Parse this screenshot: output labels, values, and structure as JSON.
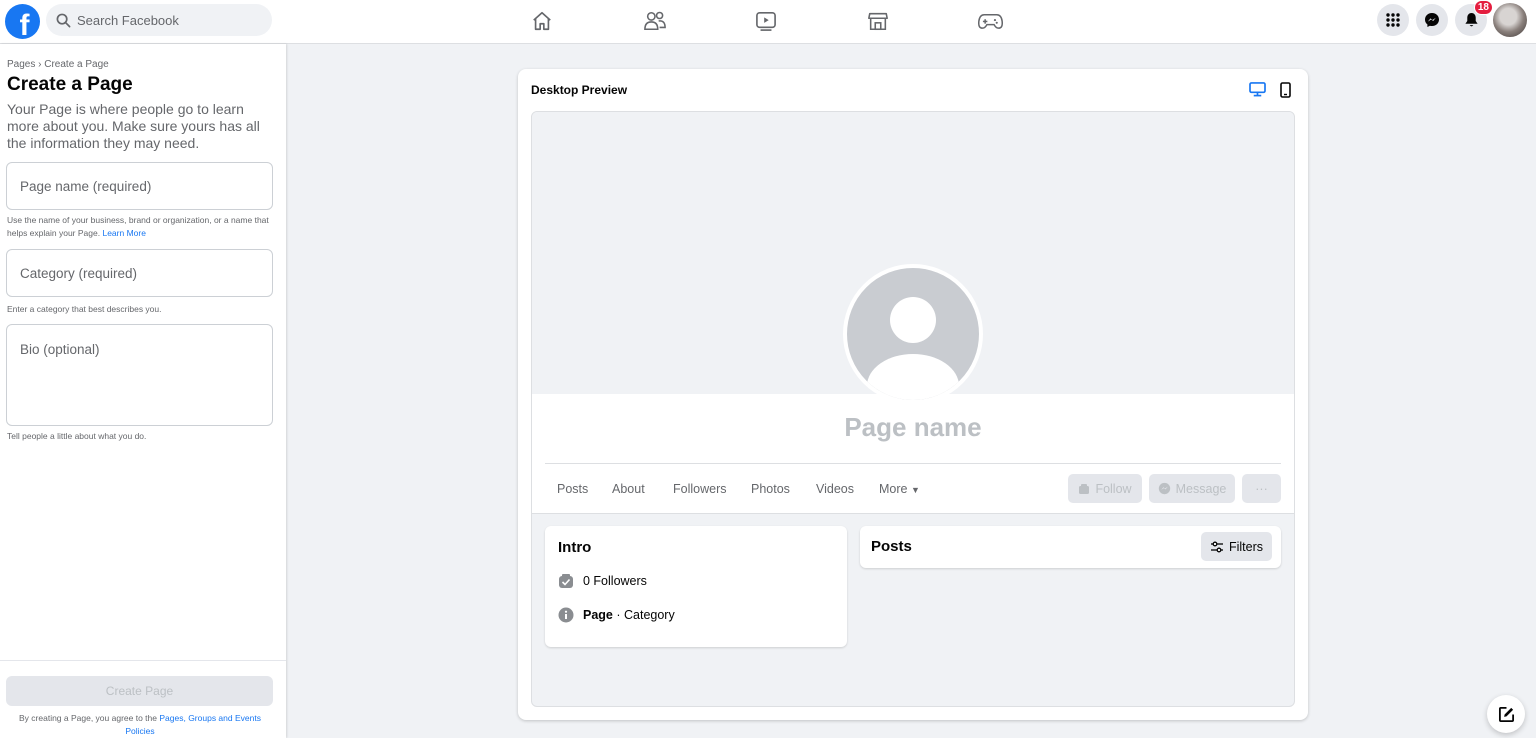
{
  "header": {
    "logo_letter": "f",
    "search_placeholder": "Search Facebook",
    "notifications_count": "18",
    "nav": [
      "home-icon",
      "friends-icon",
      "watch-icon",
      "marketplace-icon",
      "gaming-icon"
    ]
  },
  "left_panel": {
    "breadcrumb": "Pages › Create a Page",
    "title": "Create a Page",
    "description": "Your Page is where people go to learn more about you. Make sure yours has all the information they may need.",
    "page_name_placeholder": "Page name (required)",
    "page_name_hint": "Use the name of your business, brand or organization, or a name that helps explain your Page.",
    "learn_more": "Learn More",
    "category_placeholder": "Category (required)",
    "category_hint": "Enter a category that best describes you.",
    "bio_placeholder": "Bio (optional)",
    "bio_hint": "Tell people a little about what you do.",
    "create_button": "Create Page",
    "terms_prefix": "By creating a Page, you agree to the",
    "terms_link": "Pages, Groups and Events Policies"
  },
  "preview": {
    "title": "Desktop Preview",
    "page_name": "Page name",
    "tabs": [
      "Posts",
      "About",
      "Followers",
      "Photos",
      "Videos",
      "More"
    ],
    "follow": "Follow",
    "message": "Message",
    "more_dots": "···",
    "intro_title": "Intro",
    "followers": "0 Followers",
    "page_label": "Page",
    "category_label": " · Category",
    "posts_title": "Posts",
    "filters": "Filters"
  },
  "colors": {
    "accent": "#1877f2",
    "badge": "#e41e3f",
    "disabled": "#bcc0c4"
  }
}
